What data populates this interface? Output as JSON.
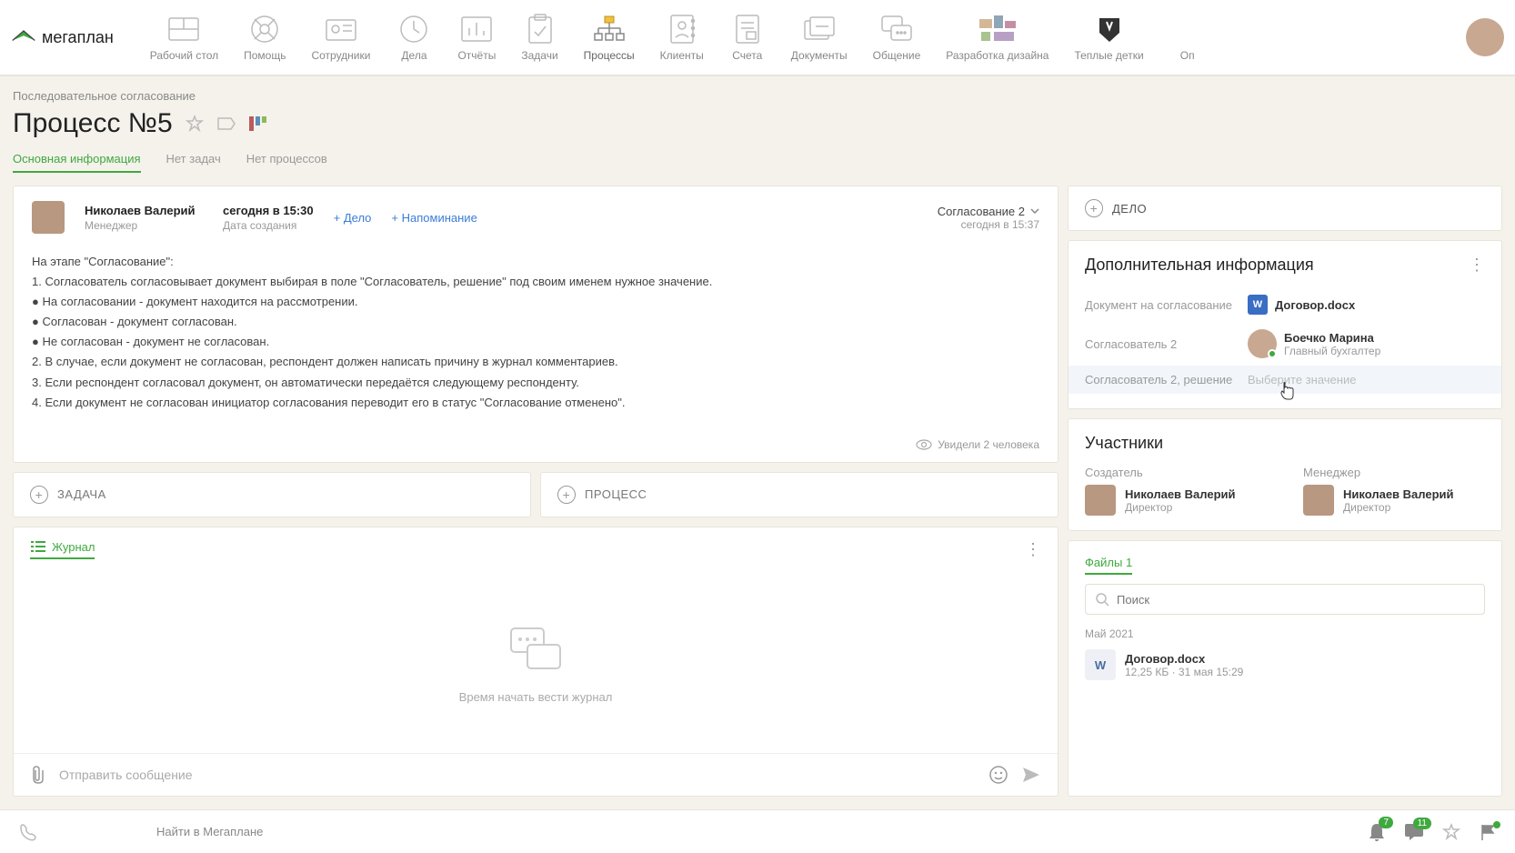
{
  "logo_text": "мегаплан",
  "nav": [
    {
      "label": "Рабочий стол"
    },
    {
      "label": "Помощь"
    },
    {
      "label": "Сотрудники"
    },
    {
      "label": "Дела"
    },
    {
      "label": "Отчёты"
    },
    {
      "label": "Задачи"
    },
    {
      "label": "Процессы",
      "active": true
    },
    {
      "label": "Клиенты"
    },
    {
      "label": "Счета"
    },
    {
      "label": "Документы"
    },
    {
      "label": "Общение"
    },
    {
      "label": "Разработка дизайна"
    },
    {
      "label": "Теплые детки"
    },
    {
      "label": "Оп"
    }
  ],
  "breadcrumb": "Последовательное согласование",
  "page_title": "Процесс №5",
  "tabs": [
    {
      "label": "Основная информация",
      "active": true
    },
    {
      "label": "Нет задач"
    },
    {
      "label": "Нет процессов"
    }
  ],
  "owner": {
    "name": "Николаев Валерий",
    "role": "Менеджер"
  },
  "created": {
    "value": "сегодня в 15:30",
    "label": "Дата создания"
  },
  "actions": {
    "delo": "+ Дело",
    "reminder": "+ Напоминание"
  },
  "stage": {
    "name": "Согласование 2",
    "time": "сегодня в 15:37"
  },
  "description": {
    "line0": "На этапе \"Согласование\":",
    "line1": "1. Согласователь согласовывает документ выбирая в поле \"Согласователь, решение\" под своим именем нужное значение.",
    "line2": "● На согласовании - документ находится на рассмотрении.",
    "line3": "● Согласован - документ согласован.",
    "line4": "● Не согласован - документ не согласован.",
    "line5": "2. В случае, если документ не согласован, респондент должен написать причину в журнал комментариев.",
    "line6": "3. Если респондент согласовал документ, он автоматически передаётся следующему респонденту.",
    "line7": "4. Если документ не согласован инициатор согласования переводит его в статус \"Согласование отменено\"."
  },
  "seen_text": "Увидели 2 человека",
  "add_task": "ЗАДАЧА",
  "add_process": "ПРОЦЕСС",
  "journal": {
    "title": "Журнал",
    "empty_text": "Время начать вести журнал"
  },
  "message_placeholder": "Отправить сообщение",
  "delo_header": "ДЕЛО",
  "extra": {
    "title": "Дополнительная информация",
    "doc_label": "Документ на согласование",
    "doc_name": "Договор.docx",
    "approver2_label": "Согласователь 2",
    "approver2_name": "Боечко Марина",
    "approver2_role": "Главный бухгалтер",
    "decision_label": "Согласователь 2, решение",
    "decision_placeholder": "Выберите значение"
  },
  "participants": {
    "title": "Участники",
    "creator_label": "Создатель",
    "creator_name": "Николаев Валерий",
    "creator_role": "Директор",
    "manager_label": "Менеджер",
    "manager_name": "Николаев Валерий",
    "manager_role": "Директор"
  },
  "files": {
    "tab_label": "Файлы",
    "tab_count": "1",
    "search_placeholder": "Поиск",
    "month": "Май 2021",
    "item_name": "Договор.docx",
    "item_meta": "12,25 КБ · 31 мая 15:29"
  },
  "global_search_placeholder": "Найти в Мегаплане",
  "bottom_badges": {
    "bell": "7",
    "chat": "11"
  }
}
